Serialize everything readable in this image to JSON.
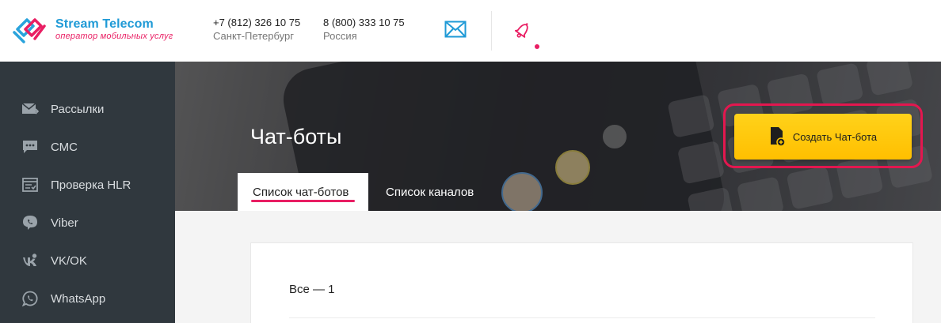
{
  "header": {
    "logo_title": "Stream Telecom",
    "logo_subtitle": "оператор мобильных услуг",
    "phones": [
      {
        "number": "+7 (812) 326 10 75",
        "city": "Санкт-Петербург"
      },
      {
        "number": "8 (800) 333 10 75",
        "city": "Россия"
      }
    ],
    "icons": [
      "mail-icon",
      "bell-icon"
    ],
    "notification_dot_color": "#e91e63"
  },
  "sidebar": {
    "items": [
      {
        "label": "Рассылки",
        "icon": "mail-send-icon"
      },
      {
        "label": "СМС",
        "icon": "sms-icon"
      },
      {
        "label": "Проверка HLR",
        "icon": "hlr-icon"
      },
      {
        "label": "Viber",
        "icon": "viber-icon"
      },
      {
        "label": "VK/OK",
        "icon": "vk-ok-icon"
      },
      {
        "label": "WhatsApp",
        "icon": "whatsapp-icon"
      }
    ]
  },
  "main": {
    "title": "Чат-боты",
    "tabs": [
      {
        "label": "Список чат-ботов",
        "active": true
      },
      {
        "label": "Список каналов",
        "active": false
      }
    ],
    "create_button": "Создать Чат-бота",
    "count_label": "Все — 1"
  },
  "colors": {
    "accent": "#e91e63",
    "brand_blue": "#1f9ad6",
    "button_yellow": "#ffc700",
    "sidebar_bg": "#30383e"
  }
}
